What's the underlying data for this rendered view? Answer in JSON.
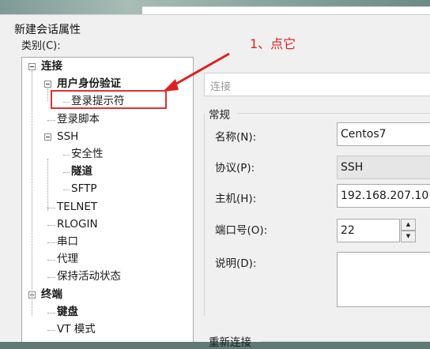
{
  "dialog": {
    "title": "新建会话属性"
  },
  "category": {
    "label": "类别(C):"
  },
  "tree": [
    {
      "label": "连接",
      "bold": true,
      "indent": 0,
      "expander": true
    },
    {
      "label": "用户身份验证",
      "bold": true,
      "indent": 1,
      "expander": true
    },
    {
      "label": "登录提示符",
      "bold": false,
      "indent": 2,
      "expander": false
    },
    {
      "label": "登录脚本",
      "bold": false,
      "indent": 1,
      "expander": false
    },
    {
      "label": "SSH",
      "bold": false,
      "indent": 1,
      "expander": true
    },
    {
      "label": "安全性",
      "bold": false,
      "indent": 2,
      "expander": false
    },
    {
      "label": "隧道",
      "bold": true,
      "indent": 2,
      "expander": false
    },
    {
      "label": "SFTP",
      "bold": false,
      "indent": 2,
      "expander": false
    },
    {
      "label": "TELNET",
      "bold": false,
      "indent": 1,
      "expander": false
    },
    {
      "label": "RLOGIN",
      "bold": false,
      "indent": 1,
      "expander": false
    },
    {
      "label": "串口",
      "bold": false,
      "indent": 1,
      "expander": false
    },
    {
      "label": "代理",
      "bold": false,
      "indent": 1,
      "expander": false
    },
    {
      "label": "保持活动状态",
      "bold": false,
      "indent": 1,
      "expander": false
    },
    {
      "label": "终端",
      "bold": true,
      "indent": 0,
      "expander": true
    },
    {
      "label": "键盘",
      "bold": true,
      "indent": 1,
      "expander": false
    },
    {
      "label": "VT 模式",
      "bold": false,
      "indent": 1,
      "expander": false
    }
  ],
  "annotation": {
    "text": "1、点它",
    "color": "#e02020"
  },
  "panel": {
    "header": "连接",
    "general_title": "常规",
    "reconnect_title": "重新连接",
    "name_label": "名称(N):",
    "name_value": "Centos7",
    "protocol_label": "协议(P):",
    "protocol_value": "SSH",
    "host_label": "主机(H):",
    "host_value": "192.168.207.10",
    "port_label": "端口号(O):",
    "port_value": "22",
    "desc_label": "说明(D):",
    "desc_value": ""
  },
  "icons": {
    "spin_up": "▲",
    "spin_down": "▼"
  }
}
